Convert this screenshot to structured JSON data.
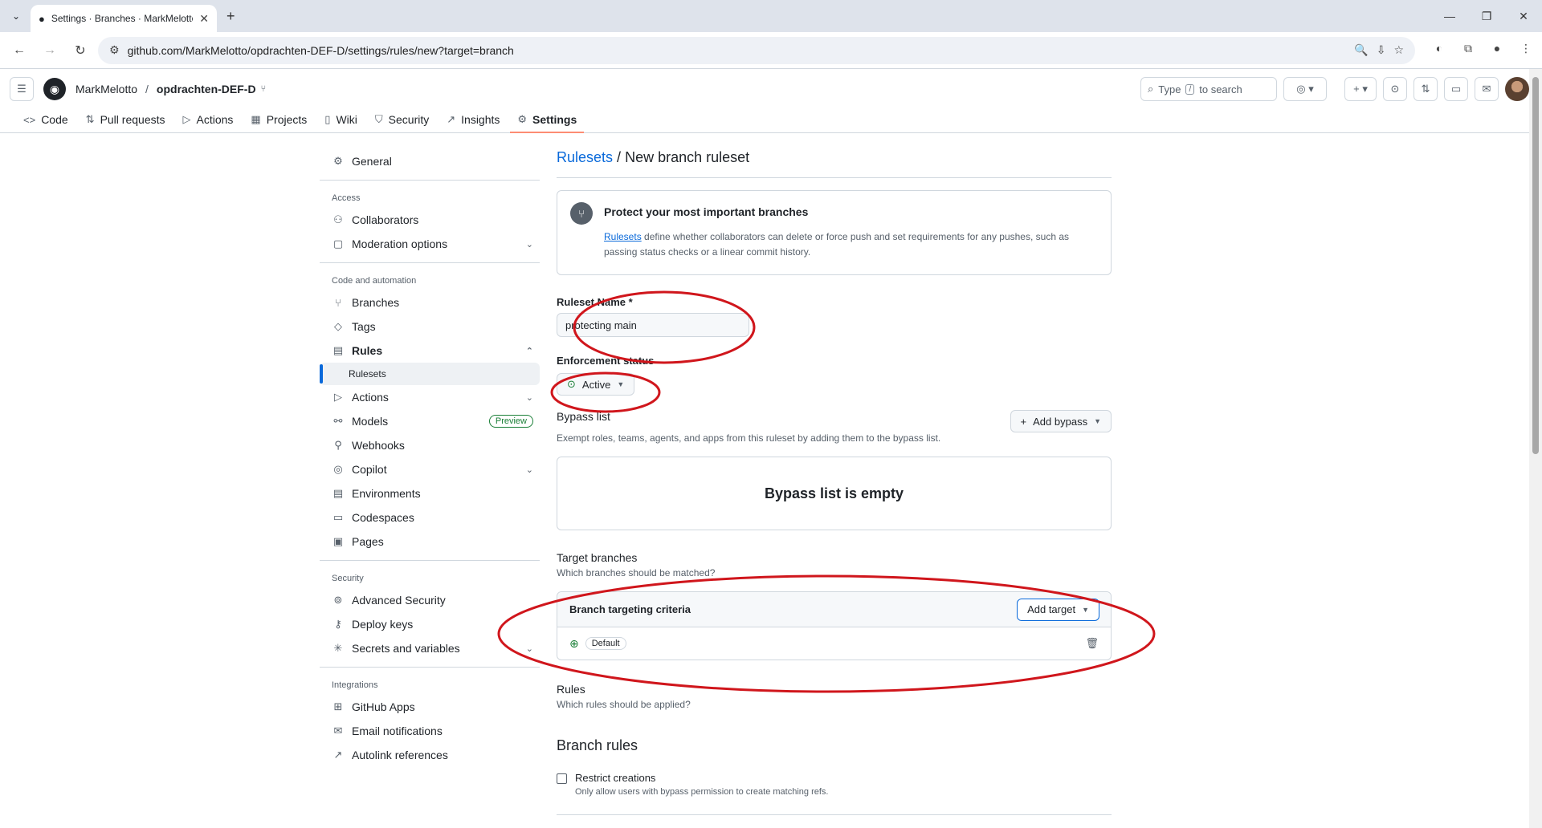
{
  "browser": {
    "tab_title": "Settings · Branches · MarkMelotto",
    "url": "github.com/MarkMelotto/opdrachten-DEF-D/settings/rules/new?target=branch"
  },
  "header": {
    "owner": "MarkMelotto",
    "separator": "/",
    "repo": "opdrachten-DEF-D",
    "search_placeholder": "Type",
    "search_key": "/",
    "search_suffix": "to search"
  },
  "repo_nav": [
    {
      "label": "Code",
      "icon": "code-icon"
    },
    {
      "label": "Pull requests",
      "icon": "pull-request-icon"
    },
    {
      "label": "Actions",
      "icon": "play-icon"
    },
    {
      "label": "Projects",
      "icon": "table-icon"
    },
    {
      "label": "Wiki",
      "icon": "book-icon"
    },
    {
      "label": "Security",
      "icon": "shield-icon"
    },
    {
      "label": "Insights",
      "icon": "graph-icon"
    },
    {
      "label": "Settings",
      "icon": "gear-icon"
    }
  ],
  "sidebar": {
    "general": "General",
    "access_heading": "Access",
    "collaborators": "Collaborators",
    "moderation": "Moderation options",
    "code_heading": "Code and automation",
    "branches": "Branches",
    "tags": "Tags",
    "rules": "Rules",
    "rulesets": "Rulesets",
    "actions": "Actions",
    "models": "Models",
    "models_badge": "Preview",
    "webhooks": "Webhooks",
    "copilot": "Copilot",
    "environments": "Environments",
    "codespaces": "Codespaces",
    "pages": "Pages",
    "security_heading": "Security",
    "advanced_security": "Advanced Security",
    "deploy_keys": "Deploy keys",
    "secrets": "Secrets and variables",
    "integrations_heading": "Integrations",
    "github_apps": "GitHub Apps",
    "email_notifications": "Email notifications",
    "autolink": "Autolink references"
  },
  "main": {
    "breadcrumb_link": "Rulesets",
    "breadcrumb_sep": "/",
    "title": "New branch ruleset",
    "info_title": "Protect your most important branches",
    "info_link": "Rulesets",
    "info_text": "define whether collaborators can delete or force push and set requirements for any pushes, such as passing status checks or a linear commit history.",
    "ruleset_name_label": "Ruleset Name *",
    "ruleset_name_value": "protecting main",
    "enforcement_label": "Enforcement status",
    "enforcement_value": "Active",
    "bypass_label": "Bypass list",
    "bypass_desc": "Exempt roles, teams, agents, and apps from this ruleset by adding them to the bypass list.",
    "add_bypass": "Add bypass",
    "bypass_empty": "Bypass list is empty",
    "target_label": "Target branches",
    "target_desc": "Which branches should be matched?",
    "targeting_criteria": "Branch targeting criteria",
    "add_target": "Add target",
    "default_pill": "Default",
    "rules_label": "Rules",
    "rules_desc": "Which rules should be applied?",
    "branch_rules": "Branch rules",
    "restrict_creations": "Restrict creations",
    "restrict_creations_desc": "Only allow users with bypass permission to create matching refs."
  },
  "colors": {
    "accent": "#0969da",
    "annotation": "#d0161c",
    "active_green": "#1a7f37",
    "tab_underline": "#fd8c73"
  }
}
